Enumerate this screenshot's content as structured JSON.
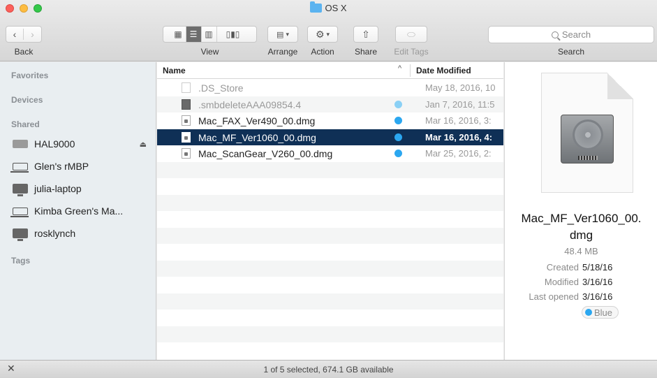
{
  "window": {
    "title": "OS X"
  },
  "toolbar": {
    "back_label": "Back",
    "view_label": "View",
    "arrange_label": "Arrange",
    "action_label": "Action",
    "share_label": "Share",
    "edit_tags_label": "Edit Tags",
    "search_label": "Search",
    "search_placeholder": "Search"
  },
  "sidebar": {
    "favorites": "Favorites",
    "devices": "Devices",
    "shared": "Shared",
    "tags": "Tags",
    "shared_items": [
      {
        "label": "HAL9000",
        "icon": "server-icon"
      },
      {
        "label": "Glen's rMBP",
        "icon": "laptop-icon"
      },
      {
        "label": "julia-laptop",
        "icon": "monitor-icon"
      },
      {
        "label": "Kimba Green's Ma...",
        "icon": "laptop-icon"
      },
      {
        "label": "rosklynch",
        "icon": "monitor-icon"
      }
    ]
  },
  "list": {
    "col_name": "Name",
    "col_date": "Date Modified",
    "sort_indicator": "^",
    "files": [
      {
        "name": ".DS_Store",
        "date": "May 18, 2016, 10",
        "tag": ""
      },
      {
        "name": ".smbdeleteAAA09854.4",
        "date": "Jan 7, 2016, 11:5",
        "tag": "Blue"
      },
      {
        "name": "Mac_FAX_Ver490_00.dmg",
        "date": "Mar 16, 2016, 3:",
        "tag": "Blue"
      },
      {
        "name": "Mac_MF_Ver1060_00.dmg",
        "date": "Mar 16, 2016, 4:",
        "tag": "Blue",
        "selected": true
      },
      {
        "name": "Mac_ScanGear_V260_00.dmg",
        "date": "Mar 25, 2016, 2:",
        "tag": "Blue"
      }
    ]
  },
  "preview": {
    "name_line1": "Mac_MF_Ver1060_00.",
    "name_line2": "dmg",
    "size": "48.4 MB",
    "created_label": "Created",
    "created_value": "5/18/16",
    "modified_label": "Modified",
    "modified_value": "3/16/16",
    "opened_label": "Last opened",
    "opened_value": "3/16/16",
    "tag": "Blue"
  },
  "status": {
    "text": "1 of 5 selected, 674.1 GB available"
  },
  "colors": {
    "selection": "#0f3056",
    "tag_blue": "#2ba7f0",
    "sidebar_bg": "#e9eef1"
  }
}
